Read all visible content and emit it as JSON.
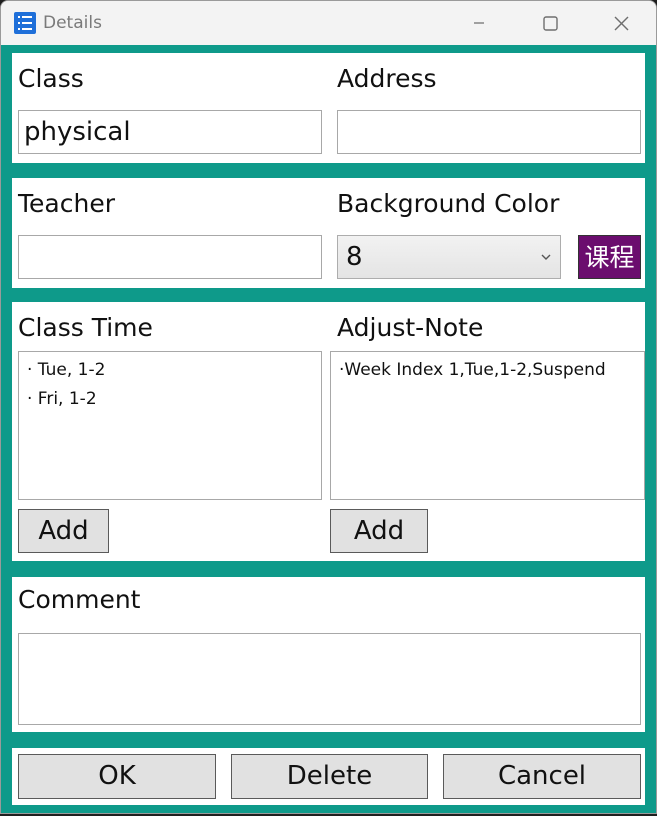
{
  "window": {
    "title": "Details",
    "app_icon": "list-app-icon",
    "controls": [
      "minimize-icon",
      "maximize-icon",
      "close-icon"
    ]
  },
  "class_section": {
    "class_label": "Class",
    "class_value": "physical",
    "address_label": "Address",
    "address_value": ""
  },
  "teacher_section": {
    "teacher_label": "Teacher",
    "teacher_value": "",
    "bg_color_label": "Background Color",
    "bg_color_value": "8",
    "swatch_text": "课程",
    "swatch_color": "#6b0d6e"
  },
  "time_section": {
    "class_time_label": "Class Time",
    "class_time_items": [
      "· Tue, 1-2",
      "· Fri, 1-2"
    ],
    "add_time_label": "Add",
    "adjust_note_label": "Adjust-Note",
    "adjust_note_items": [
      "·Week Index 1,Tue,1-2,Suspend"
    ],
    "add_note_label": "Add"
  },
  "comment_section": {
    "comment_label": "Comment",
    "comment_value": ""
  },
  "footer": {
    "ok_label": "OK",
    "delete_label": "Delete",
    "cancel_label": "Cancel"
  },
  "colors": {
    "accent_frame": "#0e9a8a",
    "button_face": "#e1e1e1"
  }
}
